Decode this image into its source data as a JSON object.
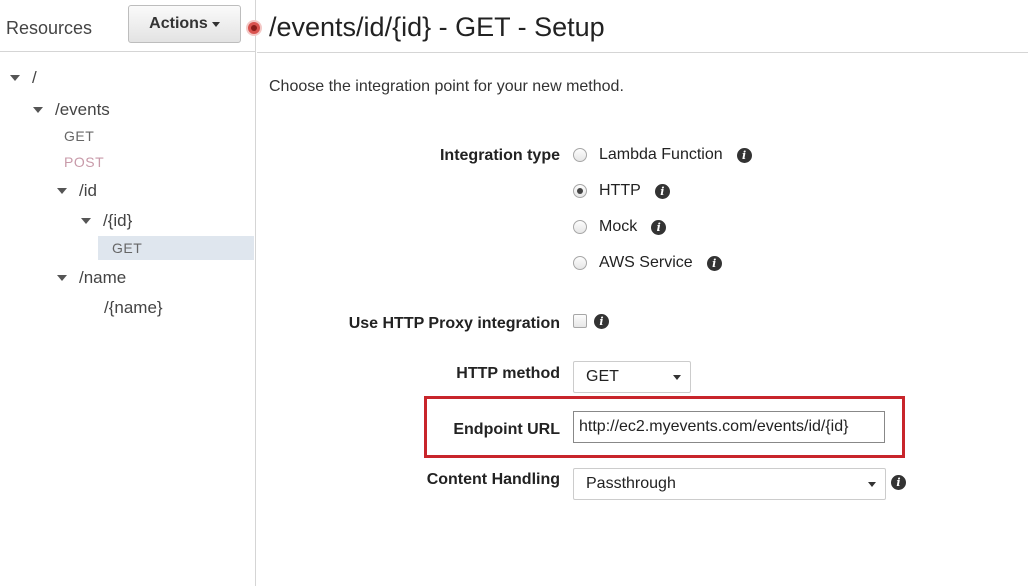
{
  "sidebar": {
    "title": "Resources",
    "actions_label": "Actions",
    "tree": {
      "root": "/",
      "events": "/events",
      "events_get": "GET",
      "events_post": "POST",
      "id": "/id",
      "id_param": "/{id}",
      "id_get": "GET",
      "name": "/name",
      "name_param": "/{name}"
    }
  },
  "main": {
    "title": "/events/id/{id} - GET - Setup",
    "intro": "Choose the integration point for your new method.",
    "integration_type": {
      "label": "Integration type",
      "options": [
        "Lambda Function",
        "HTTP",
        "Mock",
        "AWS Service"
      ],
      "selected": "HTTP"
    },
    "proxy": {
      "label": "Use HTTP Proxy integration",
      "checked": false
    },
    "http_method": {
      "label": "HTTP method",
      "value": "GET"
    },
    "endpoint_url": {
      "label": "Endpoint URL",
      "value": "http://ec2.myevents.com/events/id/{id}"
    },
    "content_handling": {
      "label": "Content Handling",
      "value": "Passthrough"
    }
  },
  "icons": {
    "info": "i",
    "collapse": "collapse-sidebar-icon"
  },
  "colors": {
    "highlight": "#c8252b",
    "selected_row": "#dfe6ee",
    "post_method": "#c89aa9"
  }
}
